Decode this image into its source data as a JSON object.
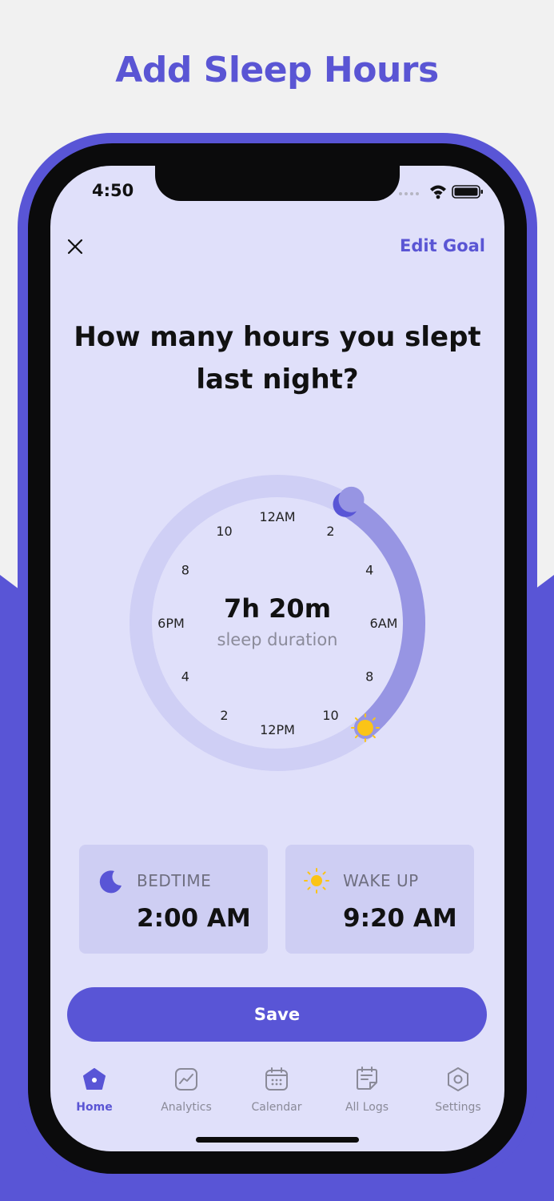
{
  "promo": {
    "title": "Add Sleep Hours"
  },
  "status_bar": {
    "time": "4:50"
  },
  "header": {
    "close_icon": "close-icon",
    "edit_goal_label": "Edit Goal"
  },
  "question": "How many hours you slept last night?",
  "dial": {
    "labels": [
      "12AM",
      "2",
      "4",
      "6AM",
      "8",
      "10",
      "12PM",
      "2",
      "4",
      "6PM",
      "8",
      "10"
    ],
    "duration": "7h 20m",
    "duration_label": "sleep duration",
    "start_icon": "moon-icon",
    "end_icon": "sun-icon"
  },
  "cards": {
    "bedtime": {
      "icon": "moon-icon",
      "label": "BEDTIME",
      "value": "2:00 AM"
    },
    "wakeup": {
      "icon": "sun-icon",
      "label": "WAKE UP",
      "value": "9:20 AM"
    }
  },
  "save_label": "Save",
  "tabs": [
    {
      "label": "Home",
      "icon": "home-icon",
      "active": true
    },
    {
      "label": "Analytics",
      "icon": "analytics-icon",
      "active": false
    },
    {
      "label": "Calendar",
      "icon": "calendar-icon",
      "active": false
    },
    {
      "label": "All Logs",
      "icon": "logs-icon",
      "active": false
    },
    {
      "label": "Settings",
      "icon": "settings-icon",
      "active": false
    }
  ],
  "colors": {
    "accent": "#5955d6",
    "screen_bg": "#e0e0fa",
    "card_bg": "#cecef3",
    "sun": "#fbc417",
    "arc": "#9795e3"
  }
}
